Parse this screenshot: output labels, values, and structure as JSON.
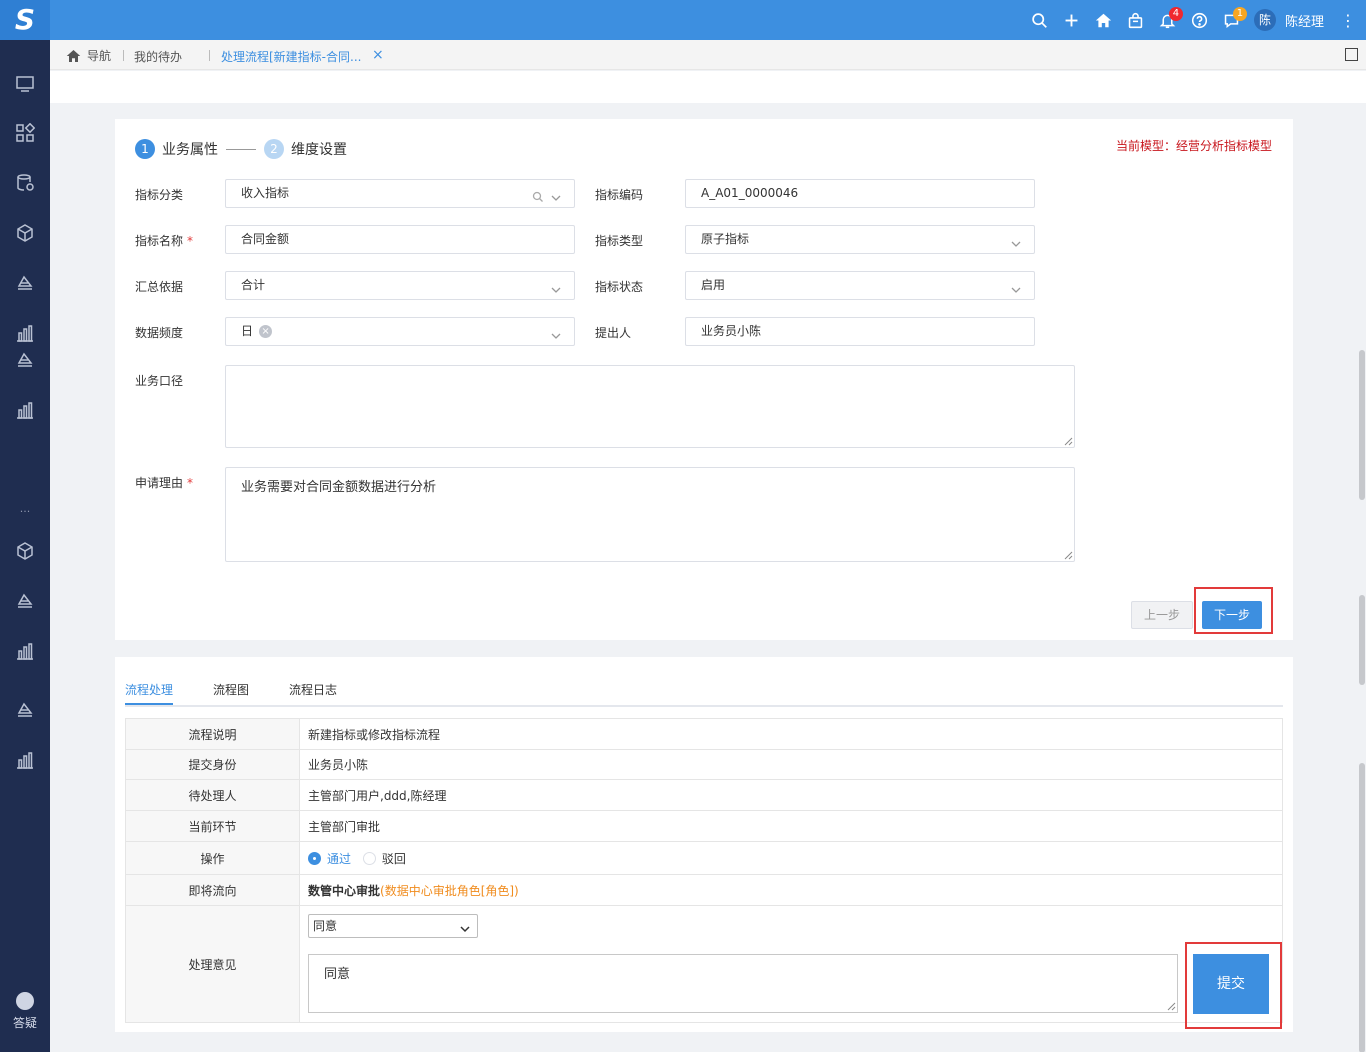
{
  "topbar": {
    "logo_icon": "app-logo",
    "user_avatar": "陈",
    "user_name": "陈经理",
    "notifications_count": "4",
    "messages_count": "1",
    "accent": "#3d8fe0"
  },
  "sidebar": {
    "dots": "...",
    "help_label": "答疑"
  },
  "tabs": {
    "home_label": "导航",
    "todo_label": "我的待办",
    "active_label": "处理流程[新建指标-合同...",
    "close": "×"
  },
  "wizard": {
    "steps": [
      {
        "num": "1",
        "label": "业务属性"
      },
      {
        "num": "2",
        "label": "维度设置"
      }
    ],
    "model": "当前模型：经营分析指标模型"
  },
  "form": {
    "category": {
      "label": "指标分类",
      "value": "收入指标"
    },
    "code": {
      "label": "指标编码",
      "value": "A_A01_0000046"
    },
    "name": {
      "label": "指标名称",
      "value": "合同金额",
      "required": "*"
    },
    "type": {
      "label": "指标类型",
      "value": "原子指标"
    },
    "aggregate": {
      "label": "汇总依据",
      "value": "合计"
    },
    "status": {
      "label": "指标状态",
      "value": "启用"
    },
    "frequency": {
      "label": "数据频度",
      "value": "日"
    },
    "proposer": {
      "label": "提出人",
      "value": "业务员小陈"
    },
    "caliber": {
      "label": "业务口径",
      "value": ""
    },
    "reason": {
      "label": "申请理由",
      "value": "业务需要对合同金额数据进行分析",
      "required": "*"
    }
  },
  "buttons": {
    "prev": "上一步",
    "next": "下一步",
    "submit": "提交"
  },
  "process": {
    "tabs": [
      "流程处理",
      "流程图",
      "流程日志"
    ],
    "rows": {
      "desc": {
        "label": "流程说明",
        "value": "新建指标或修改指标流程"
      },
      "submitter": {
        "label": "提交身份",
        "value": "业务员小陈"
      },
      "pending": {
        "label": "待处理人",
        "value": "主管部门用户,ddd,陈经理"
      },
      "current": {
        "label": "当前环节",
        "value": "主管部门审批"
      },
      "operation": {
        "label": "操作",
        "options": [
          "通过",
          "驳回"
        ],
        "selected": "通过"
      },
      "next": {
        "label": "即将流向",
        "node": "数管中心审批",
        "role": "(数据中心审批角色[角色])"
      },
      "opinion": {
        "label": "处理意见",
        "select": "同意",
        "text": "同意"
      }
    }
  },
  "colors": {
    "highlight": "#e23a3a",
    "sidebar": "#1f2d50",
    "model_text": "#c8161d",
    "role_text": "#f08c1e"
  }
}
